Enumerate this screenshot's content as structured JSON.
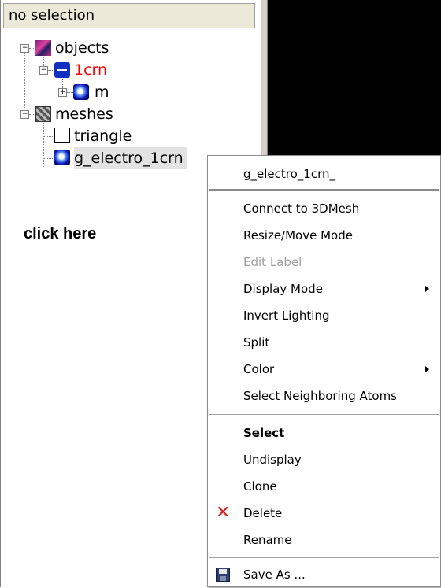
{
  "selection_bar": {
    "text": "no selection"
  },
  "tree": {
    "objects": {
      "label": "objects"
    },
    "molecule": {
      "label": "1crn",
      "color": "#ff0000"
    },
    "child_m": {
      "label": "m"
    },
    "meshes": {
      "label": "meshes"
    },
    "triangle": {
      "label": "triangle"
    },
    "mesh_item": {
      "label": "g_electro_1crn"
    }
  },
  "annotation": {
    "text": "click here"
  },
  "context_menu": {
    "header": "g_electro_1crn_",
    "items": [
      {
        "label": "Connect to 3DMesh"
      },
      {
        "label": "Resize/Move Mode"
      },
      {
        "label": "Edit Label",
        "disabled": true
      },
      {
        "label": "Display Mode",
        "submenu": true
      },
      {
        "label": "Invert Lighting"
      },
      {
        "label": "Split"
      },
      {
        "label": "Color",
        "submenu": true
      },
      {
        "label": "Select Neighboring Atoms"
      },
      {
        "label": "Select",
        "bold": true
      },
      {
        "label": "Undisplay"
      },
      {
        "label": "Clone"
      },
      {
        "label": "Delete",
        "icon": "delete-x-icon"
      },
      {
        "label": "Rename"
      },
      {
        "label": "Save As ...",
        "icon": "floppy-disk-icon"
      }
    ]
  },
  "colors": {
    "viewport": "#000000",
    "disabled_text": "#a0a0a0",
    "delete_icon": "#d62020"
  }
}
